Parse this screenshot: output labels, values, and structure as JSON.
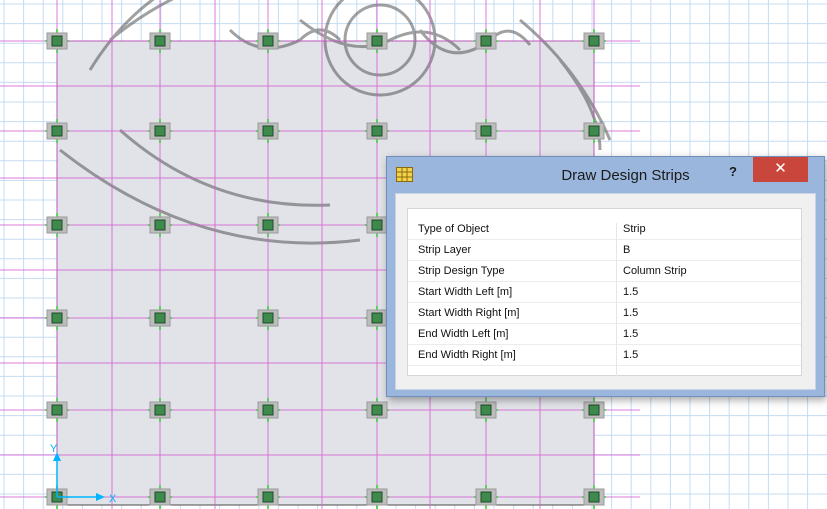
{
  "dialog": {
    "title": "Draw Design Strips",
    "help_label": "?",
    "close_label": "✕",
    "icon": "grid-app-icon",
    "properties": [
      {
        "label": "Type of Object",
        "value": "Strip"
      },
      {
        "label": "Strip Layer",
        "value": "B"
      },
      {
        "label": "Strip Design Type",
        "value": "Column Strip"
      },
      {
        "label": "Start Width Left  [m]",
        "value": "1.5"
      },
      {
        "label": "Start Width Right  [m]",
        "value": "1.5"
      },
      {
        "label": "End Width Left  [m]",
        "value": "1.5"
      },
      {
        "label": "End Width Right  [m]",
        "value": "1.5"
      }
    ]
  },
  "drawing": {
    "axis_labels": {
      "x": "X",
      "y": "Y"
    },
    "colors": {
      "background": "#ffffff",
      "fine_grid": "#c4dcf2",
      "slab": "#e1e3e8",
      "gridline": "#d65ad6",
      "column": "#3d8a4c",
      "column_outer": "#9a9a9a",
      "support": "#2ecc2e",
      "axis": "#00b4ff",
      "watermark": "#555555"
    }
  }
}
